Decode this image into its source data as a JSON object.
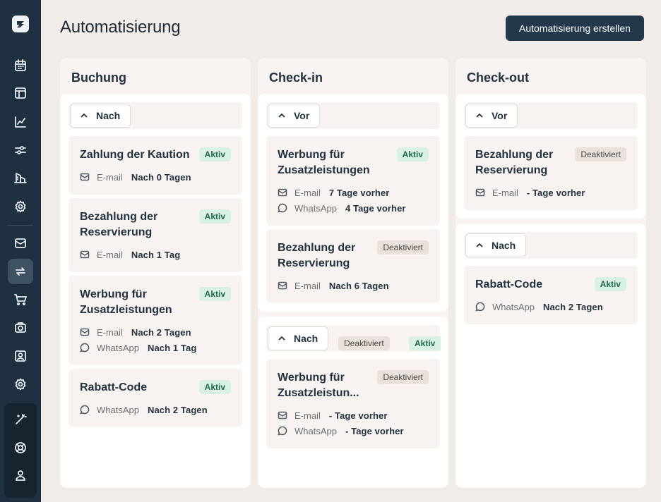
{
  "header": {
    "title": "Automatisierung",
    "create_button": "Automatisierung erstellen"
  },
  "sidebar": {
    "items": [
      {
        "icon": "calendar-icon"
      },
      {
        "icon": "layout-icon"
      },
      {
        "icon": "chart-icon"
      },
      {
        "icon": "sliders-icon"
      },
      {
        "icon": "building-icon"
      },
      {
        "icon": "settings-icon"
      },
      {
        "icon": "mail-icon"
      },
      {
        "icon": "automation-icon",
        "active": true
      },
      {
        "icon": "cart-icon"
      },
      {
        "icon": "camera-icon"
      },
      {
        "icon": "user-card-icon"
      },
      {
        "icon": "gear-icon"
      },
      {
        "icon": "magic-wand-icon"
      },
      {
        "icon": "help-icon"
      },
      {
        "icon": "user-icon"
      }
    ]
  },
  "columns": [
    {
      "title": "Buchung",
      "groups": [
        {
          "toggle": "Nach",
          "cards": [
            {
              "title": "Zahlung der Kaution",
              "status": "Aktiv",
              "lines": [
                {
                  "channel": "E-mail",
                  "timing": "Nach 0 Tagen"
                }
              ]
            },
            {
              "title": "Bezahlung der Reservierung",
              "status": "Aktiv",
              "lines": [
                {
                  "channel": "E-mail",
                  "timing": "Nach 1 Tag"
                }
              ]
            },
            {
              "title": "Werbung für Zusatzleistungen",
              "status": "Aktiv",
              "lines": [
                {
                  "channel": "E-mail",
                  "timing": "Nach 2 Tagen"
                },
                {
                  "channel": "WhatsApp",
                  "timing": "Nach 1 Tag"
                }
              ]
            },
            {
              "title": "Rabatt-Code",
              "status": "Aktiv",
              "lines": [
                {
                  "channel": "WhatsApp",
                  "timing": "Nach 2 Tagen"
                }
              ]
            }
          ]
        }
      ]
    },
    {
      "title": "Check-in",
      "groups": [
        {
          "toggle": "Vor",
          "cards": [
            {
              "title": "Werbung für Zusatzleistungen",
              "status": "Aktiv",
              "lines": [
                {
                  "channel": "E-mail",
                  "timing": "7 Tage vorher"
                },
                {
                  "channel": "WhatsApp",
                  "timing": "4 Tage vorher"
                }
              ]
            },
            {
              "title": "Bezahlung der Reservierung",
              "status": "Deaktiviert",
              "lines": [
                {
                  "channel": "E-mail",
                  "timing": "Nach 6 Tagen"
                }
              ]
            }
          ]
        },
        {
          "toggle": "Nach",
          "badges": [
            "Deaktiviert",
            "Aktiv"
          ],
          "cards": [
            {
              "title": "Werbung für Zusatzleistun...",
              "status": "Deaktiviert",
              "lines": [
                {
                  "channel": "E-mail",
                  "timing": "- Tage vorher"
                },
                {
                  "channel": "WhatsApp",
                  "timing": "- Tage vorher"
                }
              ]
            }
          ]
        }
      ]
    },
    {
      "title": "Check-out",
      "groups": [
        {
          "toggle": "Vor",
          "cards": [
            {
              "title": "Bezahlung der Reservierung",
              "status": "Deaktiviert",
              "lines": [
                {
                  "channel": "E-mail",
                  "timing": "- Tage vorher"
                }
              ]
            }
          ]
        },
        {
          "toggle": "Nach",
          "cards": [
            {
              "title": "Rabatt-Code",
              "status": "Aktiv",
              "lines": [
                {
                  "channel": "WhatsApp",
                  "timing": "Nach 2 Tagen"
                }
              ]
            }
          ]
        }
      ]
    }
  ],
  "colors": {
    "sidebar": "#1f3140",
    "accent_button": "#23394b",
    "aktiv_bg": "#d8f1e4",
    "aktiv_text": "#1f6a48",
    "deaktiviert_bg": "#e8e1dc"
  }
}
